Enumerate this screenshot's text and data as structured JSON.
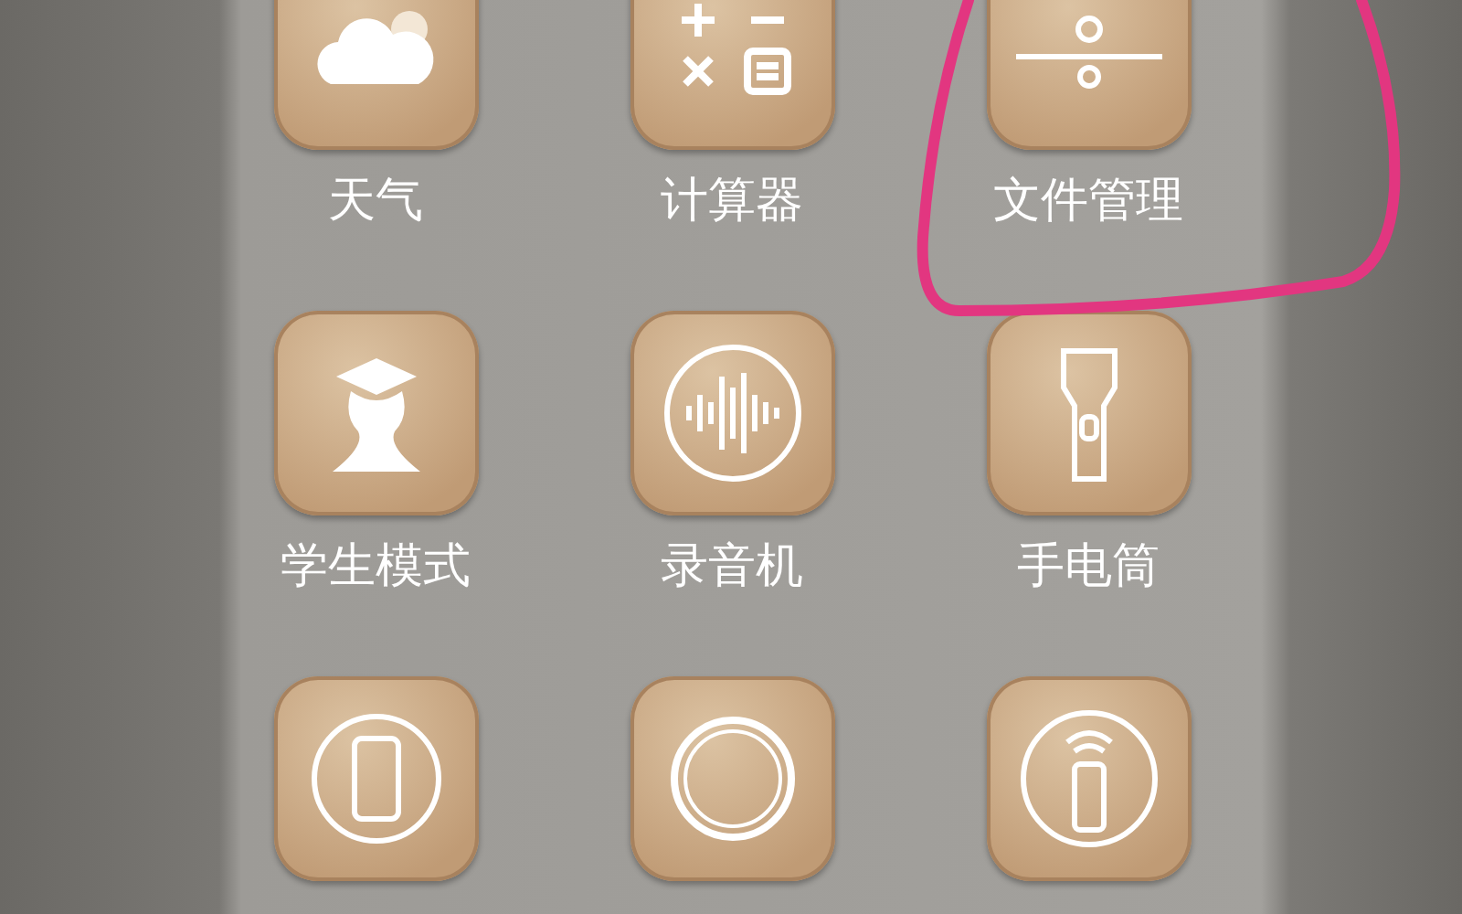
{
  "apps": [
    {
      "label": "天气"
    },
    {
      "label": "计算器"
    },
    {
      "label": "文件管理"
    },
    {
      "label": "学生模式"
    },
    {
      "label": "录音机"
    },
    {
      "label": "手电筒"
    }
  ]
}
